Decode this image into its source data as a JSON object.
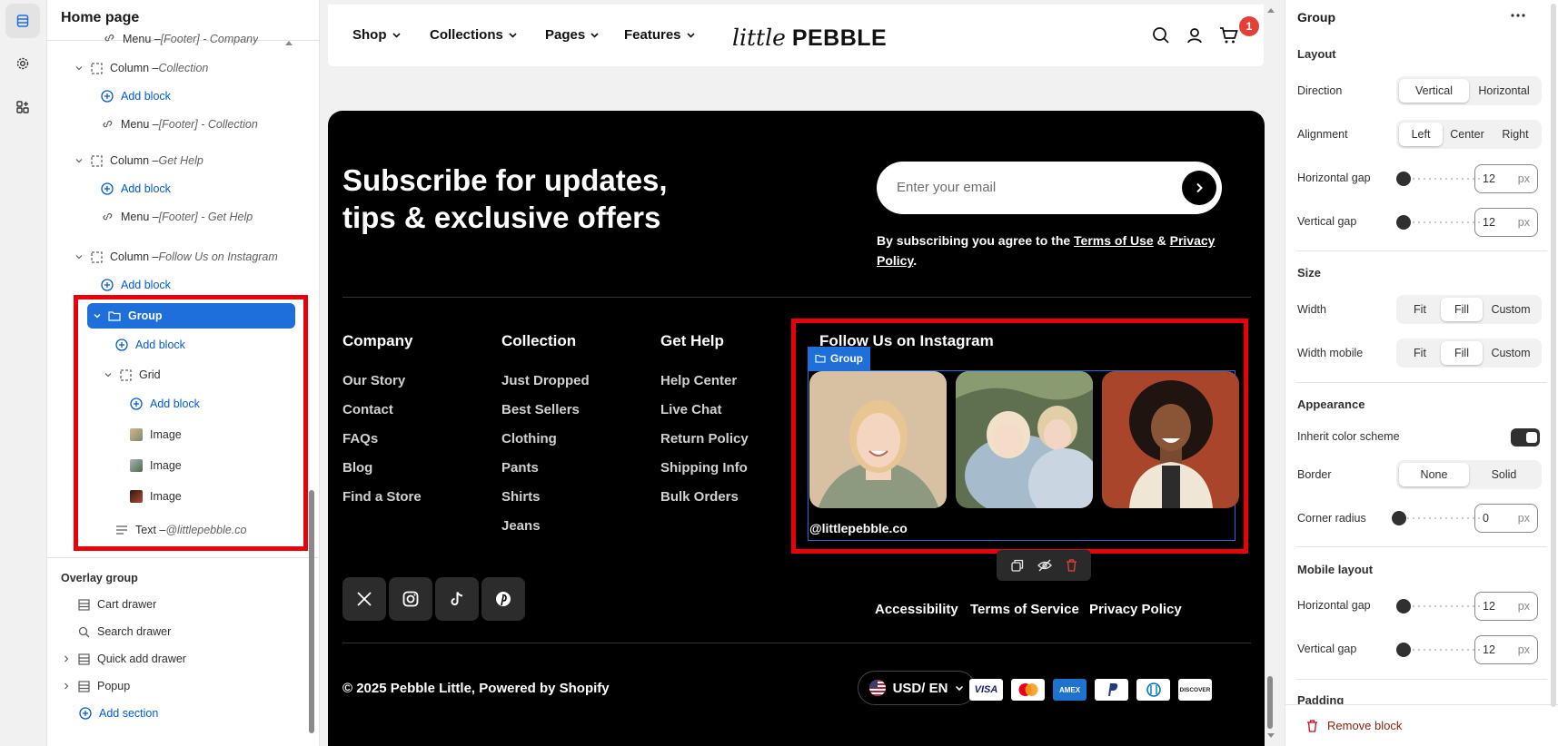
{
  "sidebar": {
    "title": "Home page",
    "rows": {
      "menu_company": {
        "prefix": "Menu – ",
        "name": "[Footer] - Company"
      },
      "col_collection": {
        "prefix": "Column – ",
        "name": "Collection"
      },
      "menu_collection": {
        "prefix": "Menu – ",
        "name": "[Footer] - Collection"
      },
      "col_gethelp": {
        "prefix": "Column – ",
        "name": "Get Help"
      },
      "menu_gethelp": {
        "prefix": "Menu – ",
        "name": "[Footer] - Get Help"
      },
      "col_instagram": {
        "prefix": "Column – ",
        "name": "Follow Us on Instagram"
      },
      "group": "Group",
      "grid": "Grid",
      "image": "Image",
      "text": {
        "prefix": "Text – ",
        "name": "@littlepebble.co"
      }
    },
    "add_block": "Add block",
    "overlay_group": {
      "title": "Overlay group",
      "items": [
        "Cart drawer",
        "Search drawer",
        "Quick add drawer",
        "Popup"
      ],
      "add_section": "Add section"
    }
  },
  "preview": {
    "nav": [
      "Shop",
      "Collections",
      "Pages",
      "Features"
    ],
    "logo": {
      "script": "little",
      "bold": "PEBBLE"
    },
    "cart_count": "1",
    "subscribe": {
      "title_line1": "Subscribe for updates,",
      "title_line2": "tips & exclusive offers",
      "placeholder": "Enter your email",
      "consent_pre": "By subscribing you agree to the ",
      "terms": "Terms of Use",
      "amp": " & ",
      "privacy": "Privacy Policy",
      "period": "."
    },
    "columns": [
      {
        "heading": "Company",
        "links": [
          "Our Story",
          "Contact",
          "FAQs",
          "Blog",
          "Find a Store"
        ]
      },
      {
        "heading": "Collection",
        "links": [
          "Just Dropped",
          "Best Sellers",
          "Clothing",
          "Pants",
          "Shirts",
          "Jeans"
        ]
      },
      {
        "heading": "Get Help",
        "links": [
          "Help Center",
          "Live Chat",
          "Return Policy",
          "Shipping Info",
          "Bulk Orders"
        ]
      }
    ],
    "instagram": {
      "heading": "Follow Us on Instagram",
      "group_tag": "Group",
      "handle": "@littlepebble.co"
    },
    "legal_links": [
      "Accessibility",
      "Terms of Service",
      "Privacy Policy"
    ],
    "copyright": "© 2025 Pebble Little, Powered by Shopify",
    "currency": "USD/ EN",
    "payments": [
      "VISA",
      "Mastercard",
      "AMEX",
      "PayPal",
      "Diners",
      "DISCOVER"
    ]
  },
  "panel": {
    "title": "Group",
    "layout": {
      "title": "Layout",
      "direction": {
        "label": "Direction",
        "options": [
          "Vertical",
          "Horizontal"
        ],
        "selected": "Vertical"
      },
      "alignment": {
        "label": "Alignment",
        "options": [
          "Left",
          "Center",
          "Right"
        ],
        "selected": "Left"
      },
      "h_gap": {
        "label": "Horizontal gap",
        "value": "12",
        "unit": "px"
      },
      "v_gap": {
        "label": "Vertical gap",
        "value": "12",
        "unit": "px"
      }
    },
    "size": {
      "title": "Size",
      "width": {
        "label": "Width",
        "options": [
          "Fit",
          "Fill",
          "Custom"
        ],
        "selected": "Fill"
      },
      "width_mobile": {
        "label": "Width mobile",
        "options": [
          "Fit",
          "Fill",
          "Custom"
        ],
        "selected": "Fill"
      }
    },
    "appearance": {
      "title": "Appearance",
      "inherit": {
        "label": "Inherit color scheme",
        "on": true
      },
      "border": {
        "label": "Border",
        "options": [
          "None",
          "Solid"
        ],
        "selected": "None"
      },
      "corner": {
        "label": "Corner radius",
        "value": "0",
        "unit": "px"
      }
    },
    "mobile": {
      "title": "Mobile layout",
      "h_gap": {
        "label": "Horizontal gap",
        "value": "12",
        "unit": "px"
      },
      "v_gap": {
        "label": "Vertical gap",
        "value": "12",
        "unit": "px"
      }
    },
    "padding_title": "Padding",
    "remove": "Remove block"
  },
  "colors": {
    "accent": "#1e6fd9",
    "highlight": "#e8000b",
    "footer_bg": "#000000",
    "link": "#005bd3",
    "danger": "#8e1f0b"
  }
}
